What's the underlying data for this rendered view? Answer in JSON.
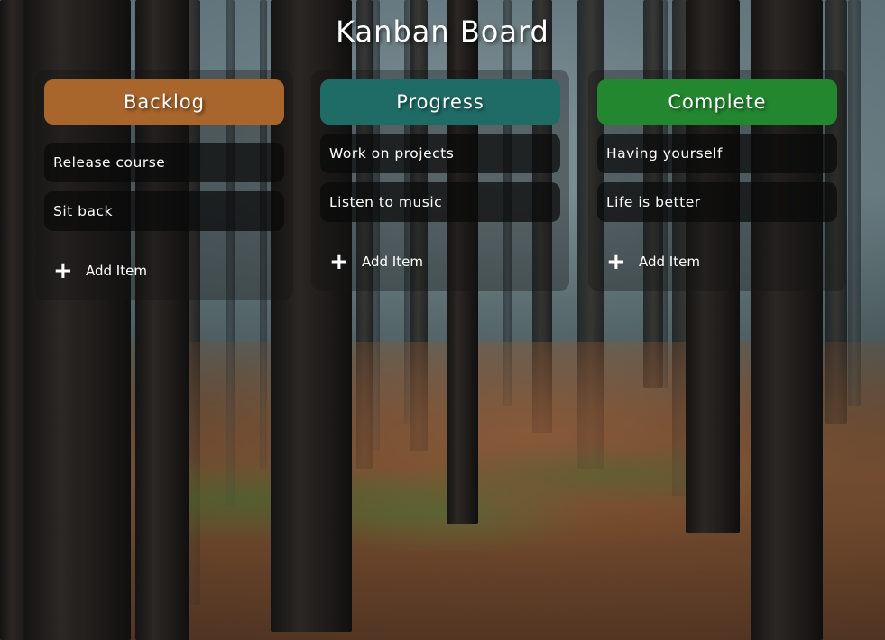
{
  "board": {
    "title": "Kanban Board"
  },
  "columns": [
    {
      "title": "Backlog",
      "color": "#a8652c",
      "items": [
        "Release course",
        "Sit back"
      ],
      "add_label": "Add Item",
      "add_icon": "plus-icon"
    },
    {
      "title": "Progress",
      "color": "#1f6b66",
      "items": [
        "Work on projects",
        "Listen to music"
      ],
      "add_label": "Add Item",
      "add_icon": "plus-icon"
    },
    {
      "title": "Complete",
      "color": "#23872f",
      "items": [
        "Having yourself",
        "Life is better"
      ],
      "add_label": "Add Item",
      "add_icon": "plus-icon"
    }
  ]
}
